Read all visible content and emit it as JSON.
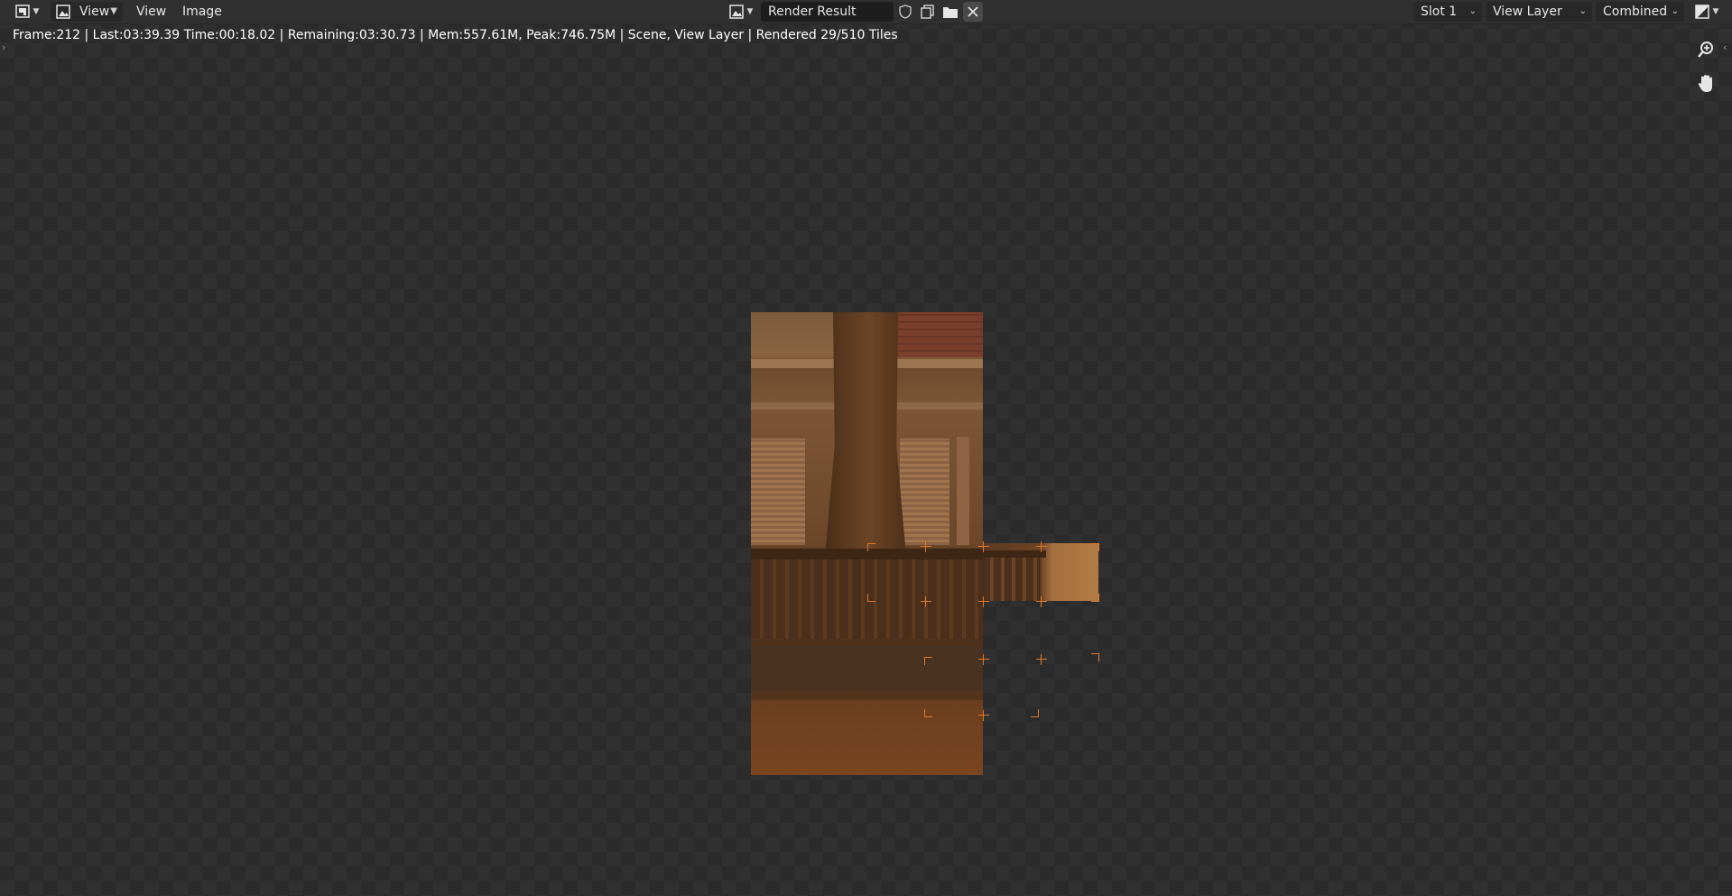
{
  "header": {
    "view_label": "View",
    "menu_view": "View",
    "menu_image": "Image",
    "image_name": "Render Result",
    "slot": "Slot 1",
    "view_layer": "View Layer",
    "pass": "Combined"
  },
  "status": {
    "text": "Frame:212 | Last:03:39.39 Time:00:18.02 | Remaining:03:30.73 | Mem:557.61M, Peak:746.75M | Scene, View Layer | Rendered 29/510 Tiles"
  },
  "icons": {
    "editor_type": "image-editor-icon",
    "zoom": "zoom-in-icon",
    "pan": "hand-icon"
  },
  "colors": {
    "accent_tile_marker": "#e07a2a",
    "header_bg": "#303030"
  }
}
